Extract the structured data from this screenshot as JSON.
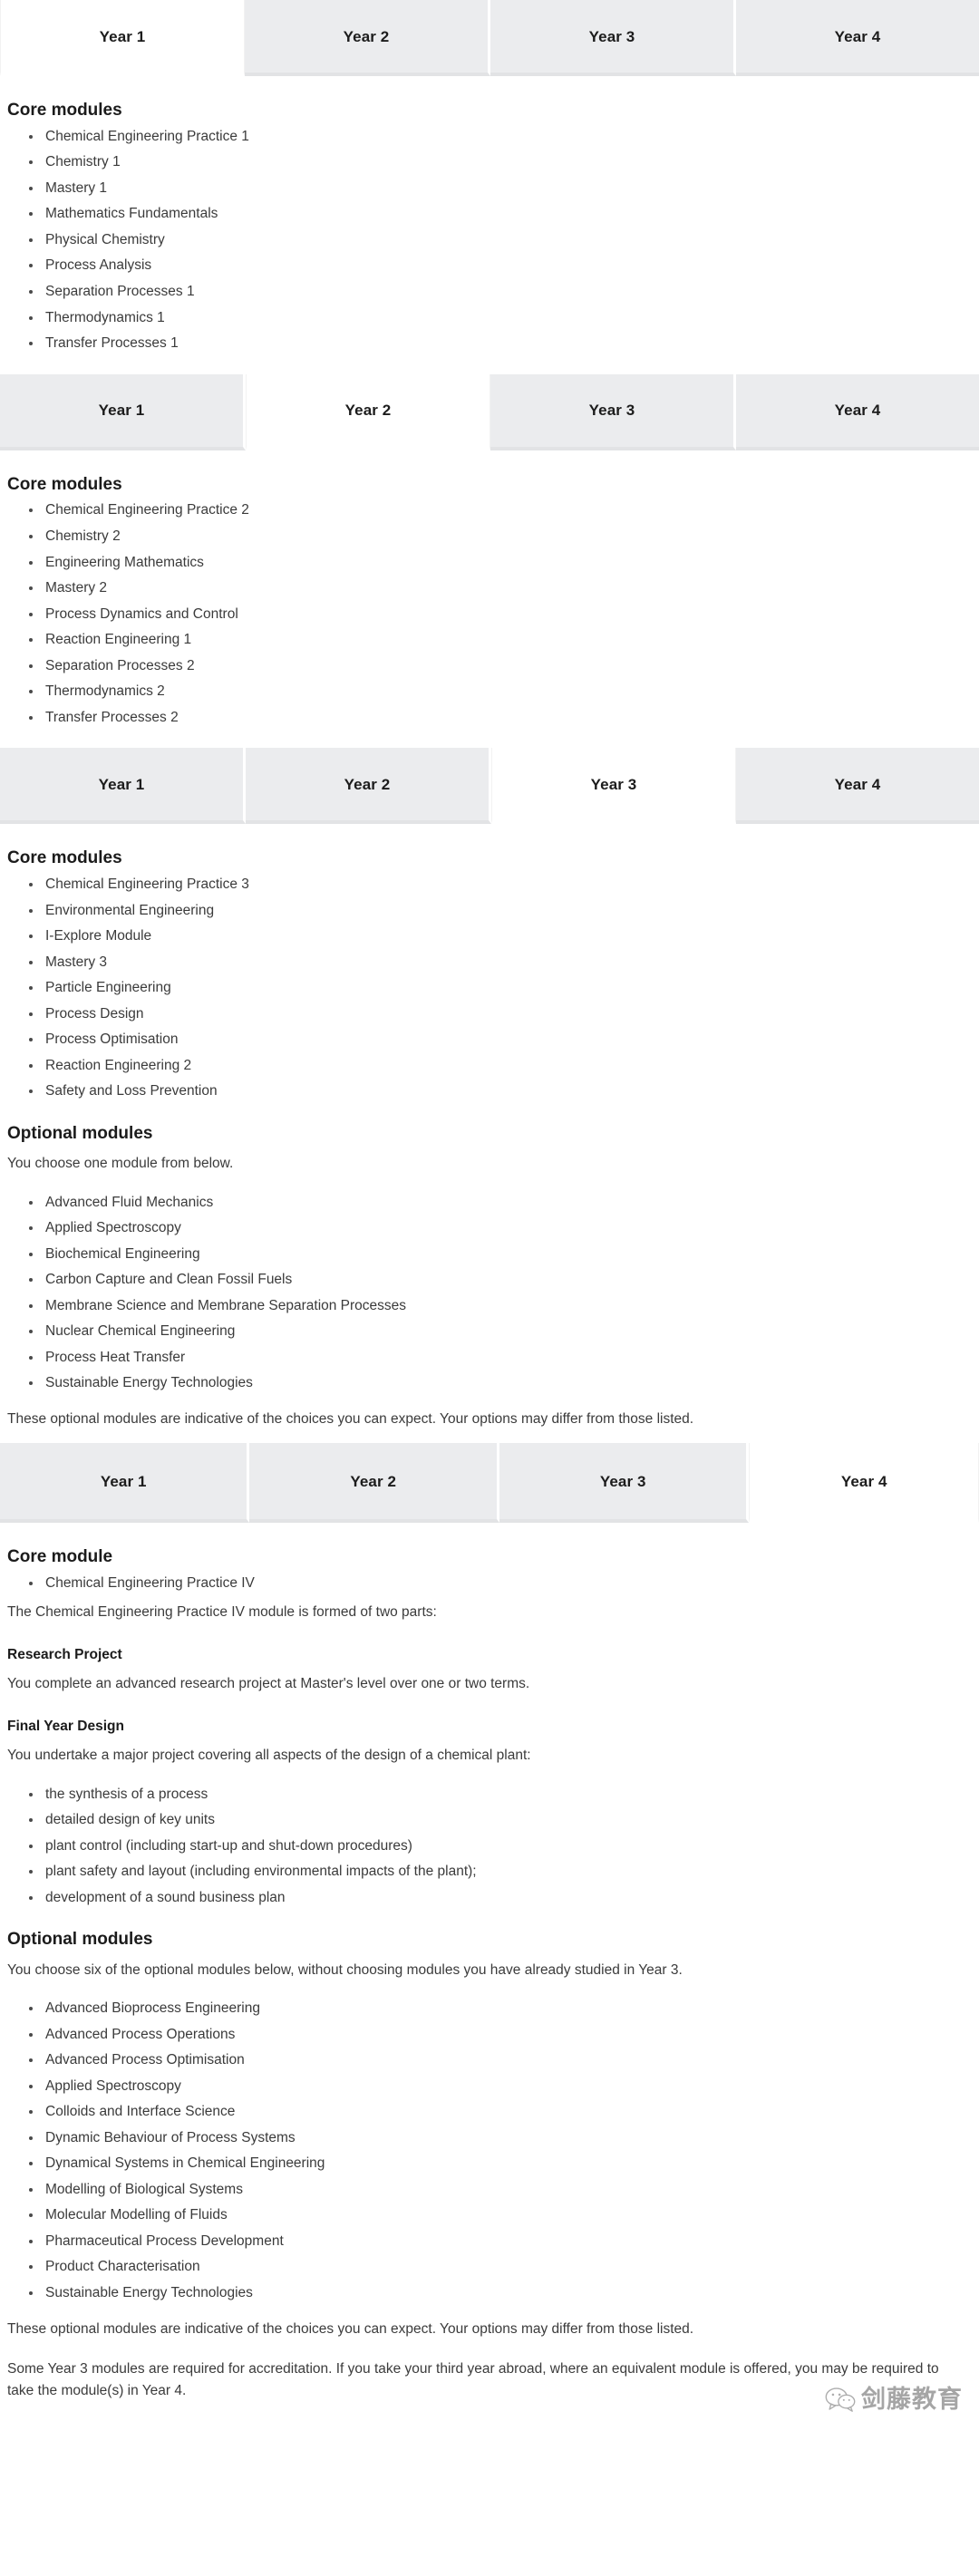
{
  "tabs": {
    "labels": [
      "Year 1",
      "Year 2",
      "Year 3",
      "Year 4"
    ],
    "bars": [
      {
        "active_index": 0
      },
      {
        "active_index": 1
      },
      {
        "active_index": 2
      },
      {
        "active_index": 3
      }
    ]
  },
  "year1": {
    "core_heading": "Core modules",
    "core_modules": [
      "Chemical Engineering Practice 1",
      "Chemistry 1",
      "Mastery 1",
      "Mathematics Fundamentals",
      "Physical Chemistry",
      "Process Analysis",
      "Separation Processes 1",
      "Thermodynamics 1",
      "Transfer Processes 1"
    ]
  },
  "year2": {
    "core_heading": "Core modules",
    "core_modules": [
      "Chemical Engineering Practice 2",
      "Chemistry 2",
      "Engineering Mathematics",
      "Mastery 2",
      "Process Dynamics and Control",
      "Reaction Engineering 1",
      "Separation Processes 2",
      "Thermodynamics 2",
      "Transfer Processes 2"
    ]
  },
  "year3": {
    "core_heading": "Core modules",
    "core_modules": [
      "Chemical Engineering Practice 3",
      "Environmental Engineering",
      "I-Explore Module",
      "Mastery 3",
      "Particle Engineering",
      "Process Design",
      "Process Optimisation",
      "Reaction Engineering 2",
      "Safety and Loss Prevention"
    ],
    "optional_heading": "Optional modules",
    "optional_intro": "You choose one module from below.",
    "optional_modules": [
      "Advanced Fluid Mechanics",
      "Applied Spectroscopy",
      "Biochemical Engineering",
      "Carbon Capture and Clean Fossil Fuels",
      "Membrane Science and Membrane Separation Processes",
      "Nuclear Chemical Engineering",
      "Process Heat Transfer",
      "Sustainable Energy Technologies"
    ],
    "disclaimer": "These optional modules are indicative of the choices you can expect. Your options may differ from those listed."
  },
  "year4": {
    "core_heading": "Core module",
    "core_modules": [
      "Chemical Engineering Practice IV"
    ],
    "parts_intro": "The Chemical Engineering Practice IV module is formed of two parts:",
    "research_project_heading": "Research Project",
    "research_project_text": "You complete an advanced research project at Master's level over one or two terms.",
    "final_year_design_heading": "Final Year Design",
    "final_year_design_text": "You undertake a major project covering all aspects of the design of a chemical plant:",
    "design_items": [
      "the synthesis of a process",
      "detailed design of key units",
      "plant control (including start-up and shut-down procedures)",
      "plant safety and layout (including environmental impacts of the plant);",
      "development of a sound business plan"
    ],
    "optional_heading": "Optional modules",
    "optional_intro": "You choose six of the optional modules below, without choosing modules you have already studied in Year 3.",
    "optional_modules": [
      "Advanced Bioprocess Engineering",
      "Advanced Process Operations",
      "Advanced Process Optimisation",
      "Applied Spectroscopy",
      "Colloids and Interface Science",
      "Dynamic Behaviour of Process Systems",
      "Dynamical Systems in Chemical Engineering",
      "Modelling of Biological Systems",
      "Molecular Modelling of Fluids",
      "Pharmaceutical Process Development",
      "Product Characterisation",
      "Sustainable Energy Technologies"
    ],
    "disclaimer": "These optional modules are indicative of the choices you can expect. Your options may differ from those listed.",
    "accreditation_note": "Some Year 3 modules are required for accreditation. If you take your third year abroad, where an equivalent module is offered, you may be required to take the module(s) in Year 4."
  },
  "watermark": {
    "text": "剑藤教育",
    "icon": "wechat-icon"
  },
  "colors": {
    "tab_inactive_bg": "#ebecee",
    "tab_active_bg": "#ffffff",
    "text": "#3b3b3b",
    "heading": "#1b1b1b"
  }
}
